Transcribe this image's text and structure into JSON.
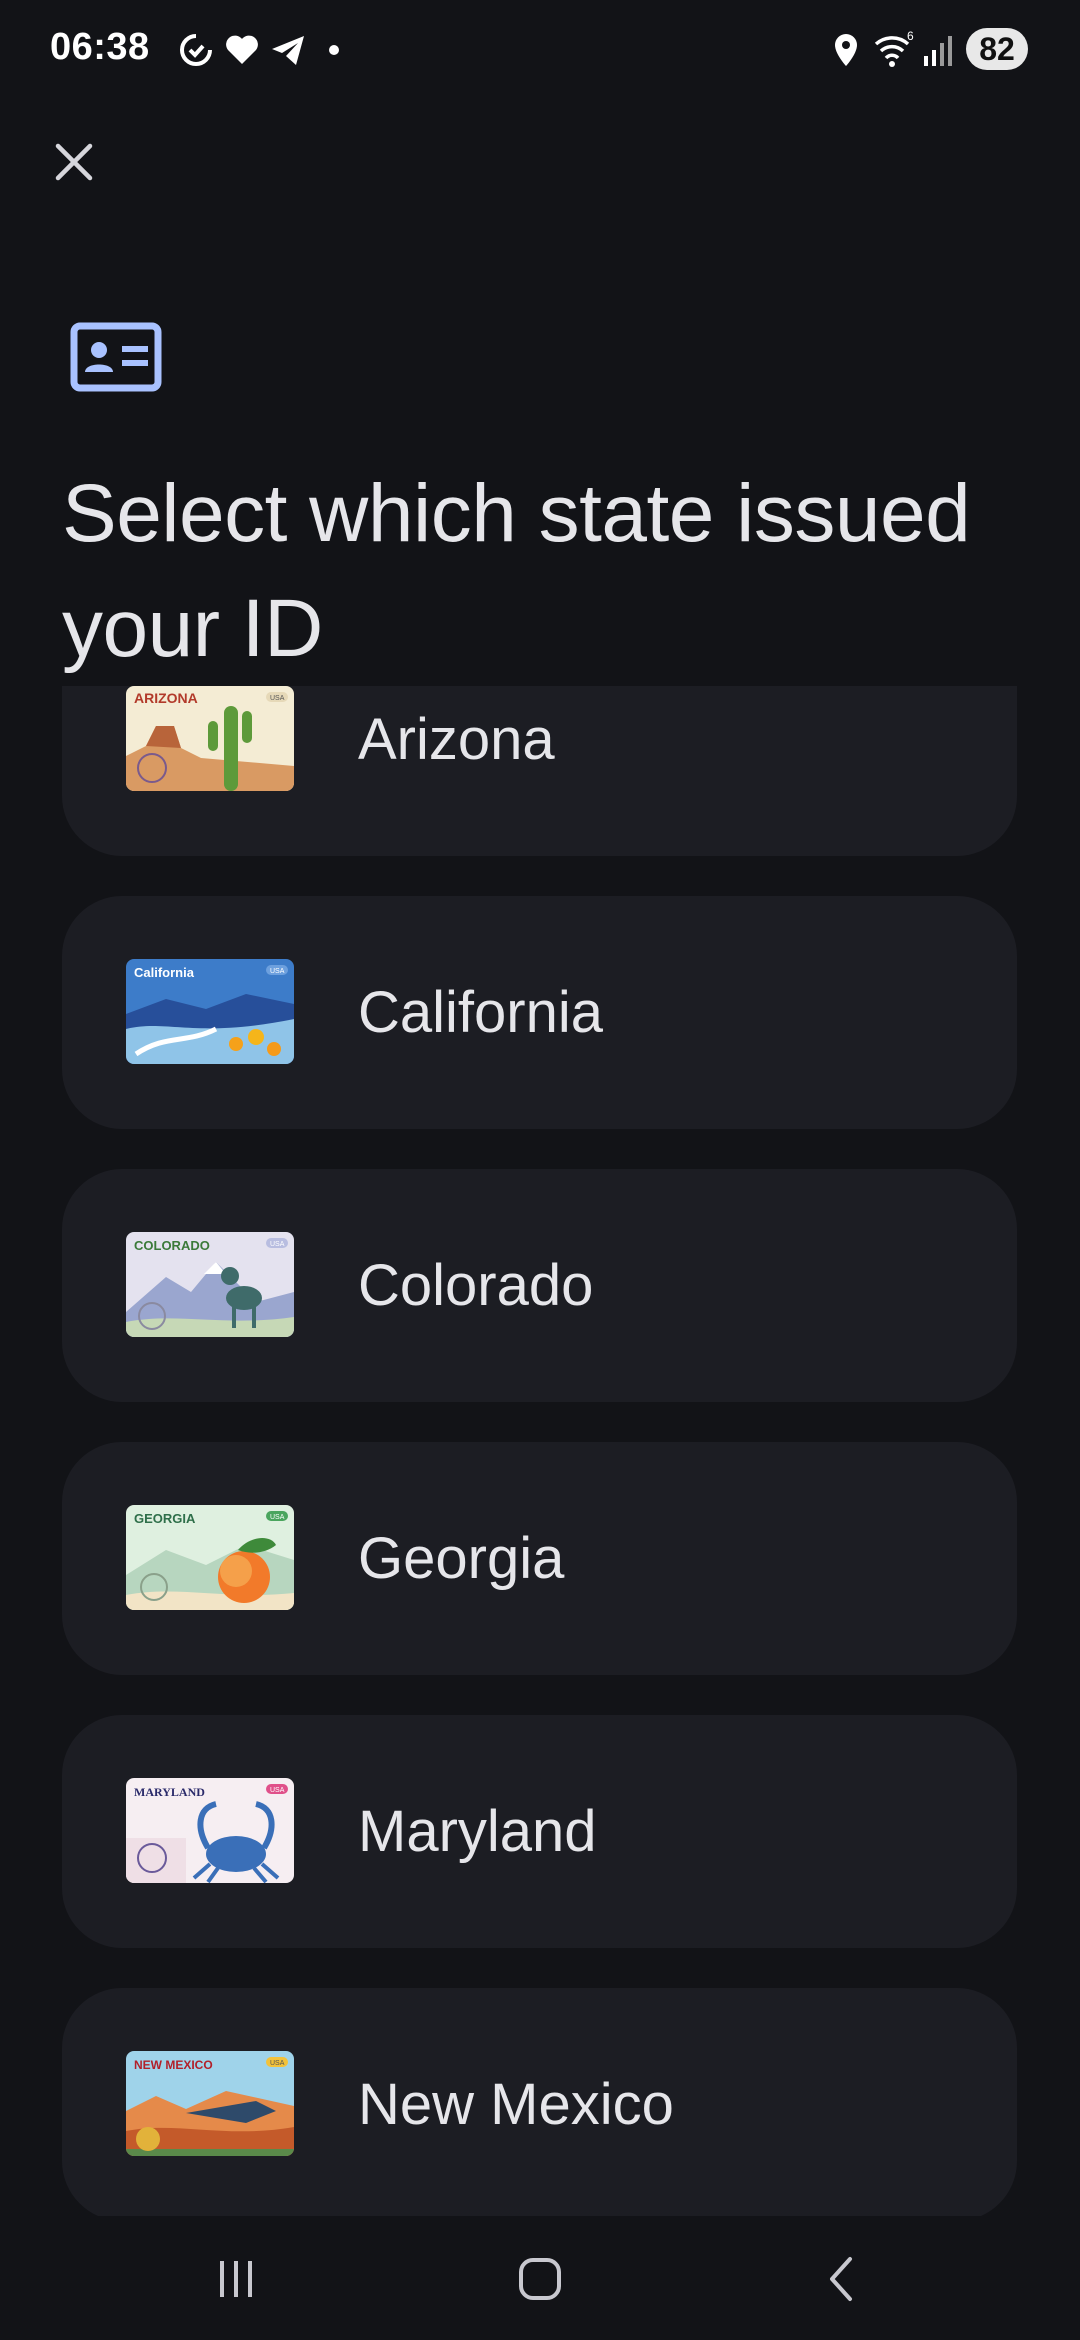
{
  "status_bar": {
    "time": "06:38",
    "battery": "82",
    "icons": [
      "data-saver-icon",
      "heart-icon",
      "telegram-icon",
      "dot-icon",
      "location-icon",
      "wifi-icon",
      "signal-icon"
    ]
  },
  "header": {
    "close_icon": "close-icon",
    "id_icon": "id-card-icon",
    "title": "Select which state issued your ID"
  },
  "states": [
    {
      "name": "Arizona",
      "card_label": "ARIZONA",
      "badge": "USA",
      "accent": "#f2e8cf"
    },
    {
      "name": "California",
      "card_label": "California",
      "badge": "USA",
      "accent": "#2f6fc0"
    },
    {
      "name": "Colorado",
      "card_label": "COLORADO",
      "badge": "USA",
      "accent": "#cfd2e8"
    },
    {
      "name": "Georgia",
      "card_label": "GEORGIA",
      "badge": "USA",
      "accent": "#dbeede"
    },
    {
      "name": "Maryland",
      "card_label": "MARYLAND",
      "badge": "USA",
      "accent": "#f3e3ea"
    },
    {
      "name": "New Mexico",
      "card_label": "NEW MEXICO",
      "badge": "USA",
      "accent": "#e9c28a"
    }
  ],
  "nav_bar": {
    "icons": [
      "recents-icon",
      "home-icon",
      "back-icon"
    ]
  },
  "colors": {
    "background": "#121317",
    "card": "#1c1d23",
    "text": "#e6e6ea",
    "icon_accent": "#a9c2ff"
  }
}
